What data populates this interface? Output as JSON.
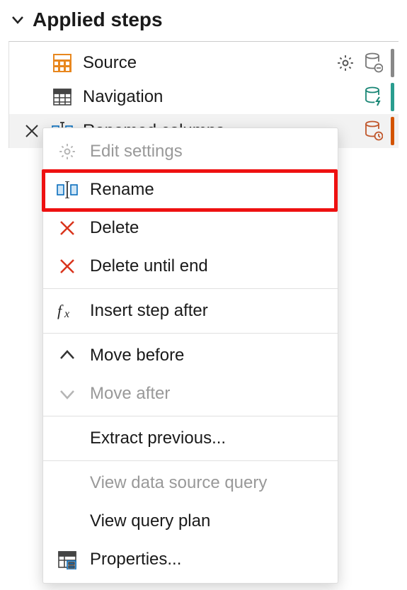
{
  "panel": {
    "title": "Applied steps"
  },
  "steps": [
    {
      "label": "Source"
    },
    {
      "label": "Navigation"
    },
    {
      "label": "Renamed columns"
    }
  ],
  "menu": {
    "edit_settings": "Edit settings",
    "rename": "Rename",
    "delete": "Delete",
    "delete_until_end": "Delete until end",
    "insert_step_after": "Insert step after",
    "move_before": "Move before",
    "move_after": "Move after",
    "extract_previous": "Extract previous...",
    "view_data_source_query": "View data source query",
    "view_query_plan": "View query plan",
    "properties": "Properties..."
  }
}
